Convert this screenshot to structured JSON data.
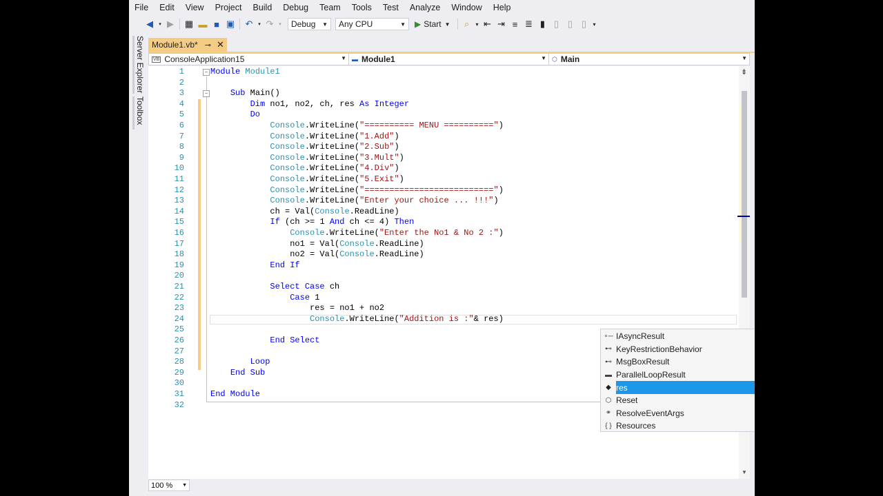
{
  "menu": [
    "File",
    "Edit",
    "View",
    "Project",
    "Build",
    "Debug",
    "Team",
    "Tools",
    "Test",
    "Analyze",
    "Window",
    "Help"
  ],
  "toolbar": {
    "config": "Debug",
    "platform": "Any CPU",
    "start_label": "Start"
  },
  "side_tabs": [
    "Server Explorer",
    "Toolbox"
  ],
  "doc_tab": {
    "title": "Module1.vb*",
    "pin": "⊸",
    "close": "✕"
  },
  "navbar": {
    "project": "ConsoleApplication15",
    "project_icon": "VB",
    "type": "Module1",
    "member": "Main"
  },
  "editor": {
    "line_numbers": [
      "1",
      "2",
      "3",
      "4",
      "5",
      "6",
      "7",
      "8",
      "9",
      "10",
      "11",
      "12",
      "13",
      "14",
      "15",
      "16",
      "17",
      "18",
      "19",
      "20",
      "21",
      "22",
      "23",
      "24",
      "25",
      "26",
      "27",
      "28",
      "29",
      "30",
      "31",
      "32"
    ],
    "lines": [
      [
        [
          "kw",
          "Module "
        ],
        [
          "ty",
          "Module1"
        ]
      ],
      [],
      [
        [
          "",
          "    "
        ],
        [
          "kw",
          "Sub "
        ],
        [
          "",
          "Main()"
        ]
      ],
      [
        [
          "",
          "        "
        ],
        [
          "kw",
          "Dim "
        ],
        [
          "",
          "no1, no2, ch, res "
        ],
        [
          "kw",
          "As Integer"
        ]
      ],
      [
        [
          "",
          "        "
        ],
        [
          "kw",
          "Do"
        ]
      ],
      [
        [
          "",
          "            "
        ],
        [
          "ty",
          "Console"
        ],
        [
          "",
          ".WriteLine("
        ],
        [
          "st",
          "\"========== MENU ==========\""
        ],
        [
          "",
          ")"
        ]
      ],
      [
        [
          "",
          "            "
        ],
        [
          "ty",
          "Console"
        ],
        [
          "",
          ".WriteLine("
        ],
        [
          "st",
          "\"1.Add\""
        ],
        [
          "",
          ")"
        ]
      ],
      [
        [
          "",
          "            "
        ],
        [
          "ty",
          "Console"
        ],
        [
          "",
          ".WriteLine("
        ],
        [
          "st",
          "\"2.Sub\""
        ],
        [
          "",
          ")"
        ]
      ],
      [
        [
          "",
          "            "
        ],
        [
          "ty",
          "Console"
        ],
        [
          "",
          ".WriteLine("
        ],
        [
          "st",
          "\"3.Mult\""
        ],
        [
          "",
          ")"
        ]
      ],
      [
        [
          "",
          "            "
        ],
        [
          "ty",
          "Console"
        ],
        [
          "",
          ".WriteLine("
        ],
        [
          "st",
          "\"4.Div\""
        ],
        [
          "",
          ")"
        ]
      ],
      [
        [
          "",
          "            "
        ],
        [
          "ty",
          "Console"
        ],
        [
          "",
          ".WriteLine("
        ],
        [
          "st",
          "\"5.Exit\""
        ],
        [
          "",
          ")"
        ]
      ],
      [
        [
          "",
          "            "
        ],
        [
          "ty",
          "Console"
        ],
        [
          "",
          ".WriteLine("
        ],
        [
          "st",
          "\"==========================\""
        ],
        [
          "",
          ")"
        ]
      ],
      [
        [
          "",
          "            "
        ],
        [
          "ty",
          "Console"
        ],
        [
          "",
          ".WriteLine("
        ],
        [
          "st",
          "\"Enter your choice ... !!!\""
        ],
        [
          "",
          ")"
        ]
      ],
      [
        [
          "",
          "            ch = Val("
        ],
        [
          "ty",
          "Console"
        ],
        [
          "",
          ".ReadLine)"
        ]
      ],
      [
        [
          "",
          "            "
        ],
        [
          "kw",
          "If "
        ],
        [
          "",
          "(ch >= 1 "
        ],
        [
          "kw",
          "And "
        ],
        [
          "",
          "ch <= 4) "
        ],
        [
          "kw",
          "Then"
        ]
      ],
      [
        [
          "",
          "                "
        ],
        [
          "ty",
          "Console"
        ],
        [
          "",
          ".WriteLine("
        ],
        [
          "st",
          "\"Enter the No1 & No 2 :\""
        ],
        [
          "",
          ")"
        ]
      ],
      [
        [
          "",
          "                no1 = Val("
        ],
        [
          "ty",
          "Console"
        ],
        [
          "",
          ".ReadLine)"
        ]
      ],
      [
        [
          "",
          "                no2 = Val("
        ],
        [
          "ty",
          "Console"
        ],
        [
          "",
          ".ReadLine)"
        ]
      ],
      [
        [
          "",
          "            "
        ],
        [
          "kw",
          "End If"
        ]
      ],
      [],
      [
        [
          "",
          "            "
        ],
        [
          "kw",
          "Select Case "
        ],
        [
          "",
          "ch"
        ]
      ],
      [
        [
          "",
          "                "
        ],
        [
          "kw",
          "Case "
        ],
        [
          "",
          "1"
        ]
      ],
      [
        [
          "",
          "                    res = no1 + no2"
        ]
      ],
      [
        [
          "",
          "                    "
        ],
        [
          "ty",
          "Console"
        ],
        [
          "",
          ".WriteLine("
        ],
        [
          "st",
          "\"Addition is :\""
        ],
        [
          "",
          "& res)"
        ]
      ],
      [],
      [
        [
          "",
          "            "
        ],
        [
          "kw",
          "End Select"
        ]
      ],
      [],
      [
        [
          "",
          "        "
        ],
        [
          "kw",
          "Loop"
        ]
      ],
      [
        [
          "",
          "    "
        ],
        [
          "kw",
          "End Sub"
        ]
      ],
      [],
      [
        [
          "kw",
          "End Module"
        ]
      ],
      []
    ]
  },
  "zoom": "100 %",
  "completion": {
    "items": [
      {
        "label": "IAsyncResult",
        "icon": "interface-icon"
      },
      {
        "label": "KeyRestrictionBehavior",
        "icon": "enum-icon"
      },
      {
        "label": "MsgBoxResult",
        "icon": "enum-icon"
      },
      {
        "label": "ParallelLoopResult",
        "icon": "struct-icon"
      },
      {
        "label": "res",
        "icon": "local-variable-icon",
        "selected": true
      },
      {
        "label": "Reset",
        "icon": "method-icon"
      },
      {
        "label": "ResolveEventArgs",
        "icon": "class-icon"
      },
      {
        "label": "Resources",
        "icon": "namespace-icon"
      }
    ]
  },
  "colors": {
    "keyword": "#0000ff",
    "type": "#2b91af",
    "string": "#a31515",
    "line_number": "#2b91af",
    "selection": "#1c97ea",
    "tab_active": "#f5cc84"
  }
}
